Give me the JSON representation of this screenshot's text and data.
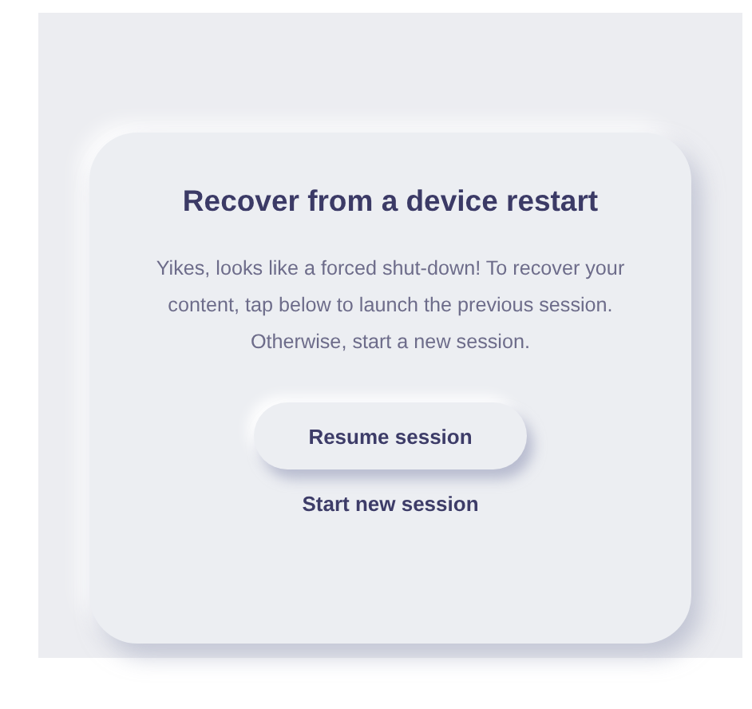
{
  "dialog": {
    "title": "Recover from a device restart",
    "message": "Yikes, looks like a forced shut-down! To recover your content, tap below to launch the previous session. Otherwise, start a new session.",
    "actions": [
      {
        "kind": "raised",
        "label": "Resume session"
      },
      {
        "kind": "link",
        "label": "Start new session"
      }
    ]
  }
}
